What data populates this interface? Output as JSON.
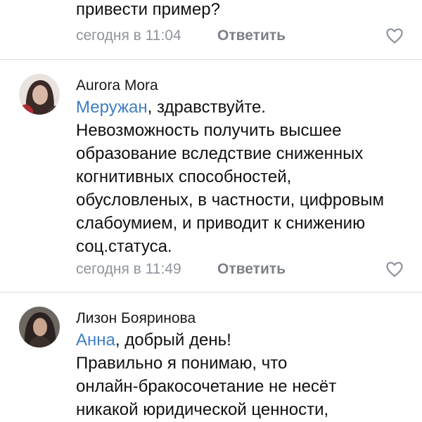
{
  "comments": [
    {
      "text_tail": "привести пример?",
      "time": "сегодня в 11:04",
      "reply_label": "Ответить",
      "icon": "heart-outline-icon"
    },
    {
      "author": "Aurora Mora",
      "mention": "Меружан",
      "greeting": ", здравствуйте.",
      "lines": [
        "Невозможность получить высшее",
        "образование вследствие сниженных",
        "когнитивных способностей,",
        "обусловленых, в частности, цифровым",
        "слабоумием, и приводит к снижению",
        "соц.статуса."
      ],
      "time": "сегодня в 11:49",
      "reply_label": "Ответить",
      "icon": "heart-outline-icon"
    },
    {
      "author": "Лизон Бояринова",
      "mention": "Анна",
      "greeting": ", добрый день!",
      "lines": [
        "Правильно я понимаю, что",
        "онлайн-бракосочетание не несёт",
        "никакой юридической ценности,"
      ]
    }
  ],
  "colors": {
    "mention": "#3f7fc1",
    "meta": "#8f959c",
    "divider": "#d9dbde"
  }
}
